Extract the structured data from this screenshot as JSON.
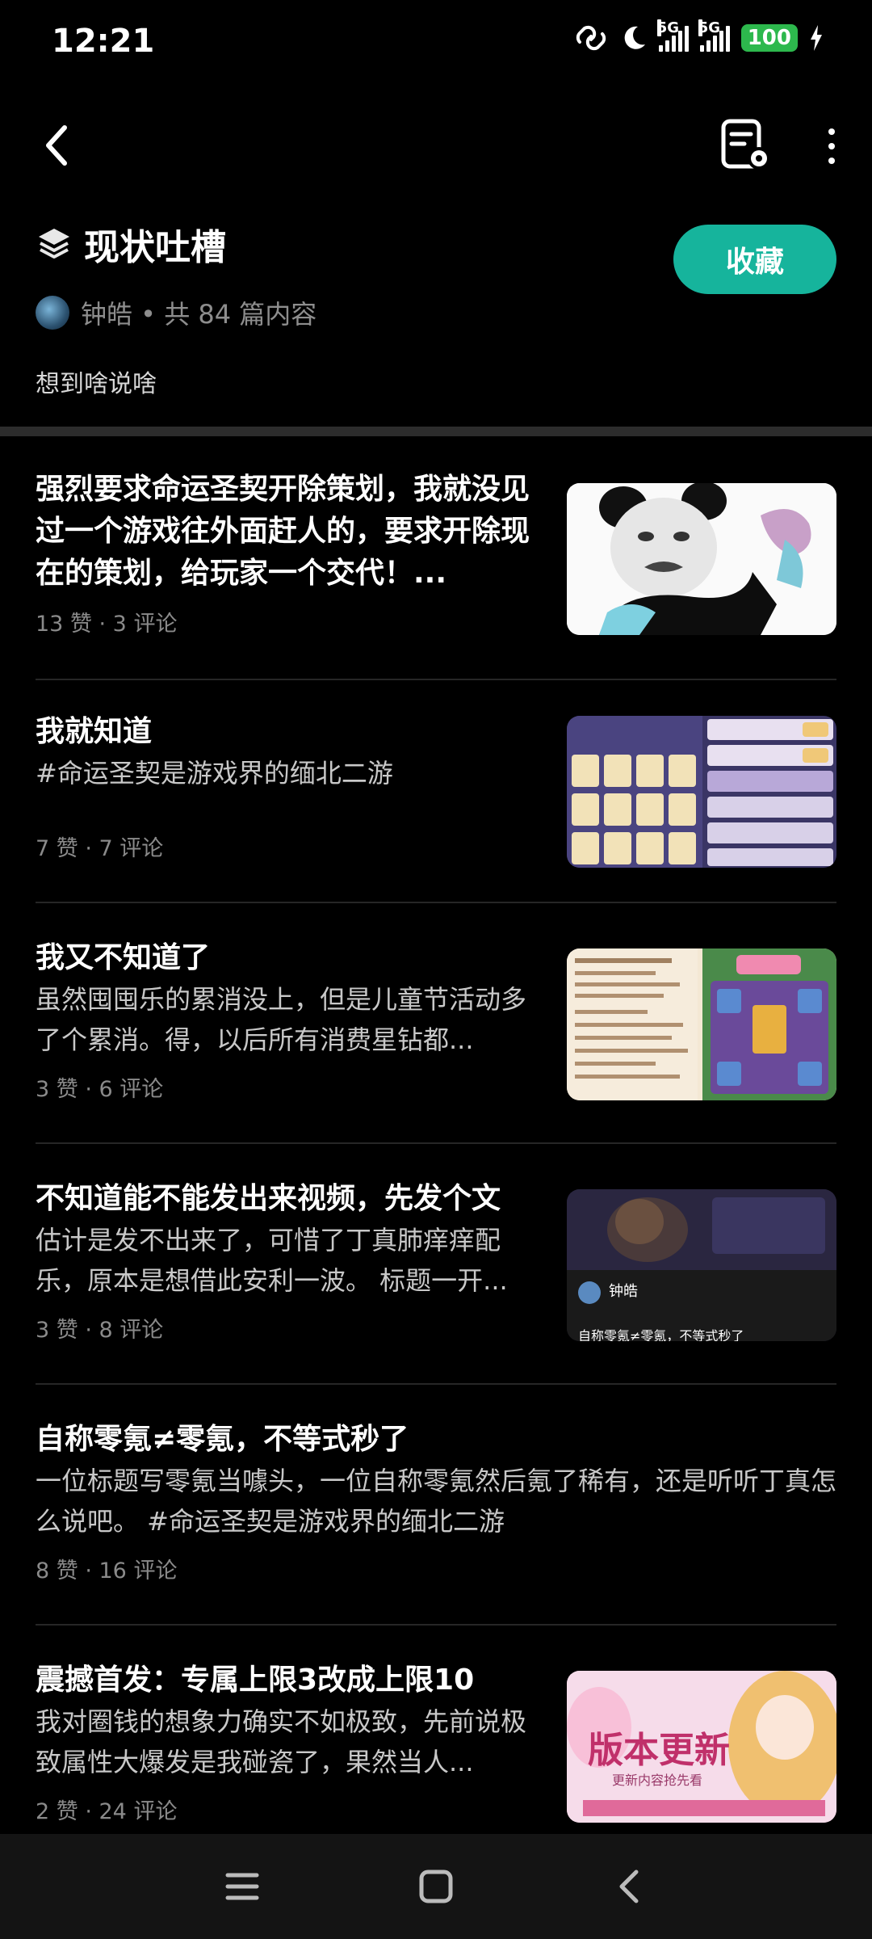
{
  "status_bar": {
    "time": "12:21",
    "network_label_1": "5G",
    "network_label_2": "5G",
    "battery": "100"
  },
  "nav": {
    "back_icon": "chevron-left-icon",
    "settings_icon": "document-settings-icon",
    "more_icon": "more-vertical-icon"
  },
  "collection": {
    "icon": "layers-icon",
    "title": "现状吐槽",
    "meta": "钟皓 • 共 84 篇内容",
    "description": "想到啥说啥",
    "favorite_label": "收藏",
    "accent": "#16b49c"
  },
  "posts": [
    {
      "title": "强烈要求命运圣契开除策划，我就没见过一个游戏往外面赶人的，要求开除现在的策划，给玩家一个交代！...",
      "body": "",
      "stats": "13 赞  ·  3 评论",
      "thumb": "meme-panda-face"
    },
    {
      "title": "我就知道",
      "body": "#命运圣契是游戏界的缅北二游",
      "stats": "7 赞  ·  7 评论",
      "thumb": "game-shop-screenshot"
    },
    {
      "title": "我又不知道了",
      "body": "虽然囤囤乐的累消没上，但是儿童节活动多了个累消。得，以后所有消费星钻都...",
      "stats": "3 赞  ·  6 评论",
      "thumb": "event-notice-screenshot"
    },
    {
      "title": "不知道能不能发出来视频，先发个文",
      "body": "估计是发不出来了，可惜了丁真肺痒痒配乐，原本是想借此安利一波。 标题一开...",
      "stats": "3 赞  ·  8 评论",
      "thumb": "video-preview",
      "thumb_user": "钟皓",
      "thumb_caption": "自称零氪≠零氪，不等式秒了"
    },
    {
      "title": "自称零氪≠零氪，不等式秒了",
      "body": "一位标题写零氪当噱头，一位自称零氪然后氪了稀有，还是听听丁真怎么说吧。 #命运圣契是游戏界的缅北二游",
      "stats": "8 赞  ·  16 评论"
    },
    {
      "title": "震撼首发：专属上限3改成上限10",
      "body": "我对圈钱的想象力确实不如极致，先前说极致属性大爆发是我碰瓷了，果然当人...",
      "stats": "2 赞  ·  24 评论",
      "thumb": "version-update-banner",
      "thumb_title": "版本更新",
      "thumb_sub": "更新内容抢先看"
    }
  ],
  "bottom_nav": {
    "menu_icon": "menu-icon",
    "home_icon": "home-square-icon",
    "back_icon": "back-triangle-icon"
  }
}
